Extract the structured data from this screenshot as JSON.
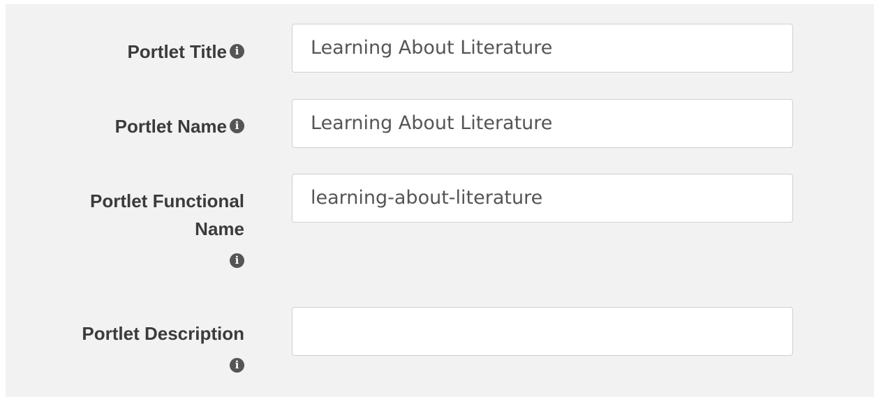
{
  "form": {
    "fields": [
      {
        "label": "Portlet Title",
        "value": "Learning About Literature",
        "info_icon": "info-circle-icon"
      },
      {
        "label": "Portlet Name",
        "value": "Learning About Literature",
        "info_icon": "info-circle-icon"
      },
      {
        "label_line1": "Portlet Functional",
        "label_line2": "Name",
        "value": "learning-about-literature",
        "info_icon": "info-circle-icon"
      },
      {
        "label": "Portlet Description",
        "value": "",
        "info_icon": "info-circle-icon"
      }
    ],
    "info_glyph": "i"
  },
  "colors": {
    "panel_background": "#f2f2f2",
    "label_text": "#3b3b3b",
    "input_text": "#555555",
    "input_border": "#d0d0d0",
    "icon": "#555555"
  }
}
